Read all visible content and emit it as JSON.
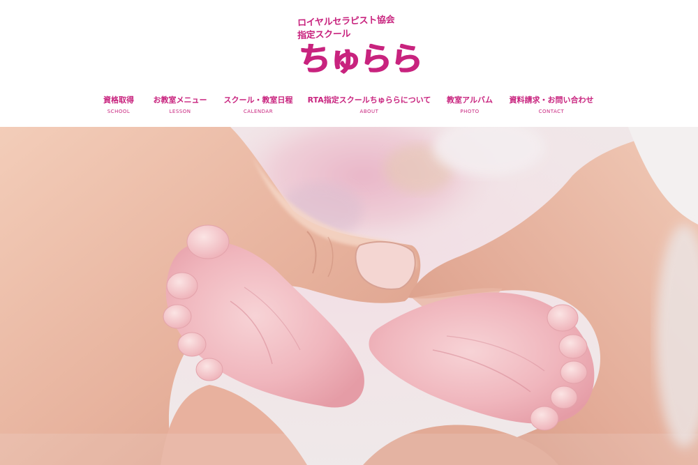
{
  "logo": {
    "line1": "ロイヤルセラピスト協会",
    "line2": "指定スクール",
    "name": "ちゅらら"
  },
  "nav": [
    {
      "ja": "資格取得",
      "en": "SCHOOL"
    },
    {
      "ja": "お教室メニュー",
      "en": "LESSON"
    },
    {
      "ja": "スクール・教室日程",
      "en": "CALENDAR"
    },
    {
      "ja": "RTA指定スクールちゅららについて",
      "en": "ABOUT"
    },
    {
      "ja": "教室アルバム",
      "en": "PHOTO"
    },
    {
      "ja": "資料請求・お問い合わせ",
      "en": "CONTACT"
    }
  ],
  "colors": {
    "brand": "#c8237e",
    "background": "#ffffff"
  },
  "hero": {
    "image": "photo-baby-feet-in-hands"
  }
}
